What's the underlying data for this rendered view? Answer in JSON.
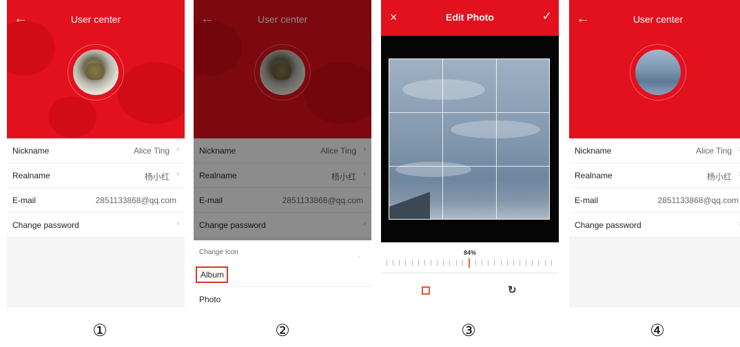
{
  "labels": [
    "①",
    "②",
    "③",
    "④"
  ],
  "user_center": {
    "title": "User center",
    "rows": [
      {
        "label": "Nickname",
        "value": "Alice Ting",
        "arrow": "›"
      },
      {
        "label": "Realname",
        "value": "杨小红",
        "arrow": "›"
      },
      {
        "label": "E-mail",
        "value": "2851133868@qq.com"
      },
      {
        "label": "Change password",
        "arrow": "›"
      }
    ]
  },
  "sheet": {
    "title": "Change Icon",
    "dot": "·",
    "album": "Album",
    "photo": "Photo"
  },
  "edit": {
    "title": "Edit Photo",
    "close_icon": "×",
    "confirm_icon": "✓",
    "zoom": "84%",
    "rotate_icon": "↻"
  },
  "colors": {
    "accent": "#e3101e",
    "highlight": "#d9342b",
    "slider": "#e46b2e"
  },
  "icons": [
    "back-arrow-icon",
    "close-icon",
    "check-icon",
    "crop-icon",
    "rotate-icon",
    "chevron-right-icon"
  ]
}
